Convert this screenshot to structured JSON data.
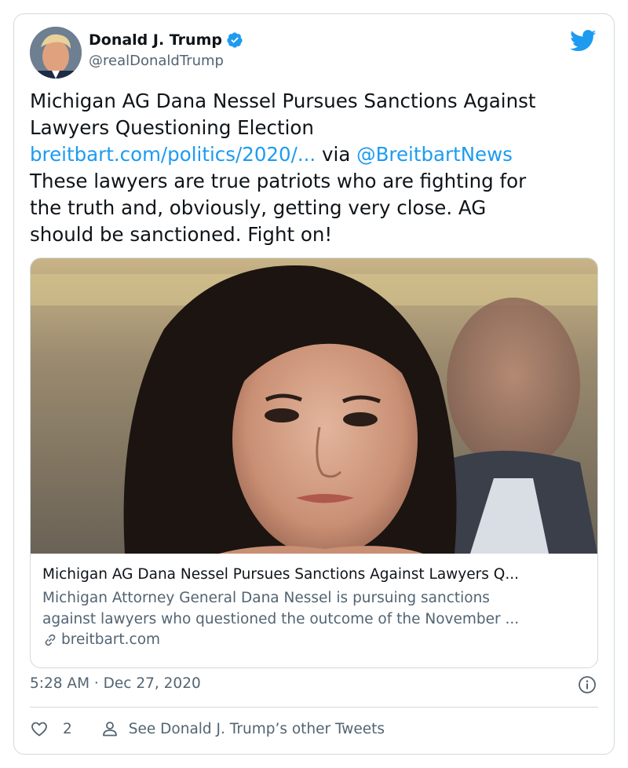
{
  "author": {
    "name": "Donald J. Trump",
    "handle": "@realDonaldTrump"
  },
  "tweet": {
    "line1": "Michigan AG Dana Nessel Pursues Sanctions Against",
    "line2": "Lawyers Questioning Election",
    "link": "breitbart.com/politics/2020/...",
    "via": " via ",
    "mention": "@BreitbartNews",
    "line4": "These lawyers are true patriots who are fighting for",
    "line5": "the truth and, obviously, getting very close. AG",
    "line6": "should be sanctioned. Fight on!"
  },
  "card": {
    "title": "Michigan AG Dana Nessel Pursues Sanctions Against Lawyers Q...",
    "desc1": "Michigan Attorney General Dana Nessel is pursuing sanctions",
    "desc2": "against lawyers who questioned the outcome of the November ...",
    "domain": "breitbart.com"
  },
  "meta": {
    "time": "5:28 AM · Dec 27, 2020"
  },
  "actions": {
    "likes": "2",
    "other": "See Donald J. Trump’s other Tweets"
  },
  "colors": {
    "link": "#1d9bf0",
    "muted": "#536471",
    "border": "#cfd9de"
  }
}
